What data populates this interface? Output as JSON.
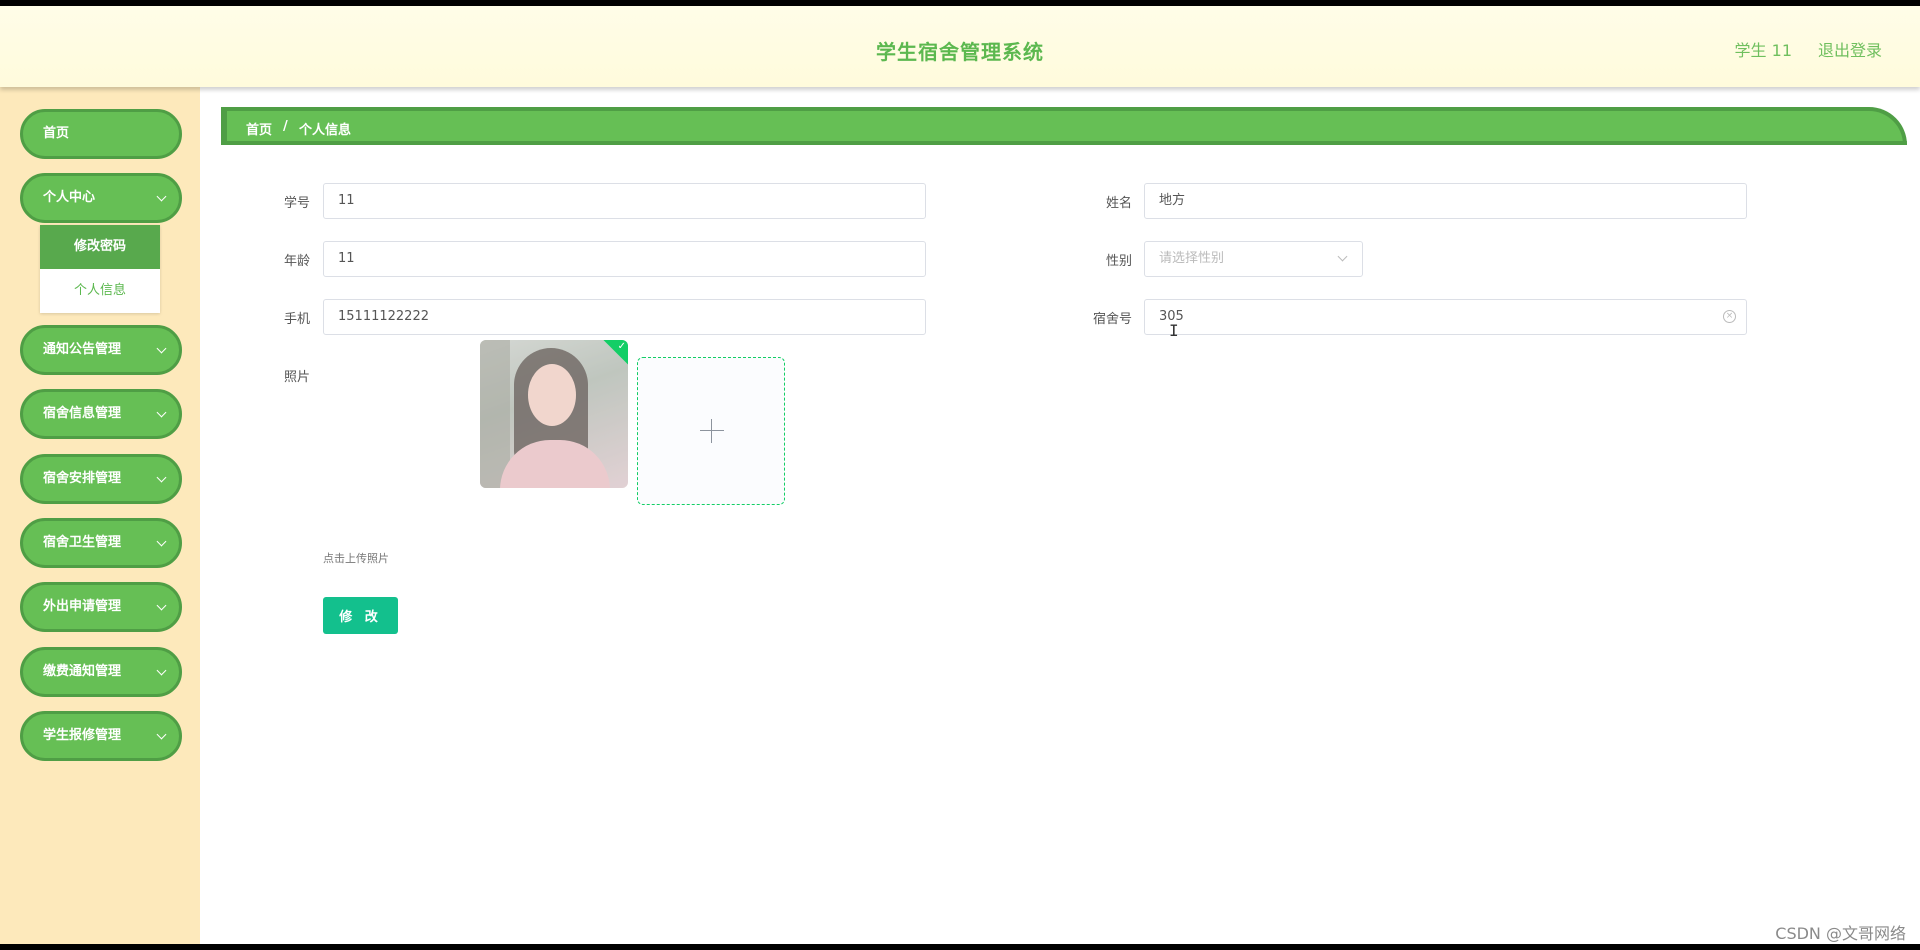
{
  "header": {
    "title": "学生宿舍管理系统",
    "user": "学生 11",
    "logout": "退出登录"
  },
  "sidebar": {
    "items": [
      {
        "label": "首页"
      },
      {
        "label": "个人中心"
      },
      {
        "label": "通知公告管理"
      },
      {
        "label": "宿舍信息管理"
      },
      {
        "label": "宿舍安排管理"
      },
      {
        "label": "宿舍卫生管理"
      },
      {
        "label": "外出申请管理"
      },
      {
        "label": "缴费通知管理"
      },
      {
        "label": "学生报修管理"
      }
    ],
    "submenu": [
      {
        "label": "修改密码"
      },
      {
        "label": "个人信息"
      }
    ]
  },
  "breadcrumb": {
    "home": "首页",
    "separator": "/",
    "current": "个人信息"
  },
  "form": {
    "student_id": {
      "label": "学号",
      "value": "11"
    },
    "name": {
      "label": "姓名",
      "value": "地方"
    },
    "age": {
      "label": "年龄",
      "value": "11"
    },
    "gender": {
      "label": "性别",
      "placeholder": "请选择性别"
    },
    "phone": {
      "label": "手机",
      "value": "15111122222"
    },
    "dorm": {
      "label": "宿舍号",
      "value": "305"
    },
    "photo": {
      "label": "照片",
      "tip": "点击上传照片"
    },
    "submit": "修 改"
  },
  "watermark": "CSDN @文哥网络",
  "icons": {
    "chevron": "chevron-down-icon",
    "plus": "plus-icon",
    "clear": "circle-close-icon",
    "check": "check-icon"
  },
  "colors": {
    "primary_green": "#66bf55",
    "dark_green": "#4f9e45",
    "sidebar_bg": "#fde9bb",
    "button": "#13c08d"
  }
}
